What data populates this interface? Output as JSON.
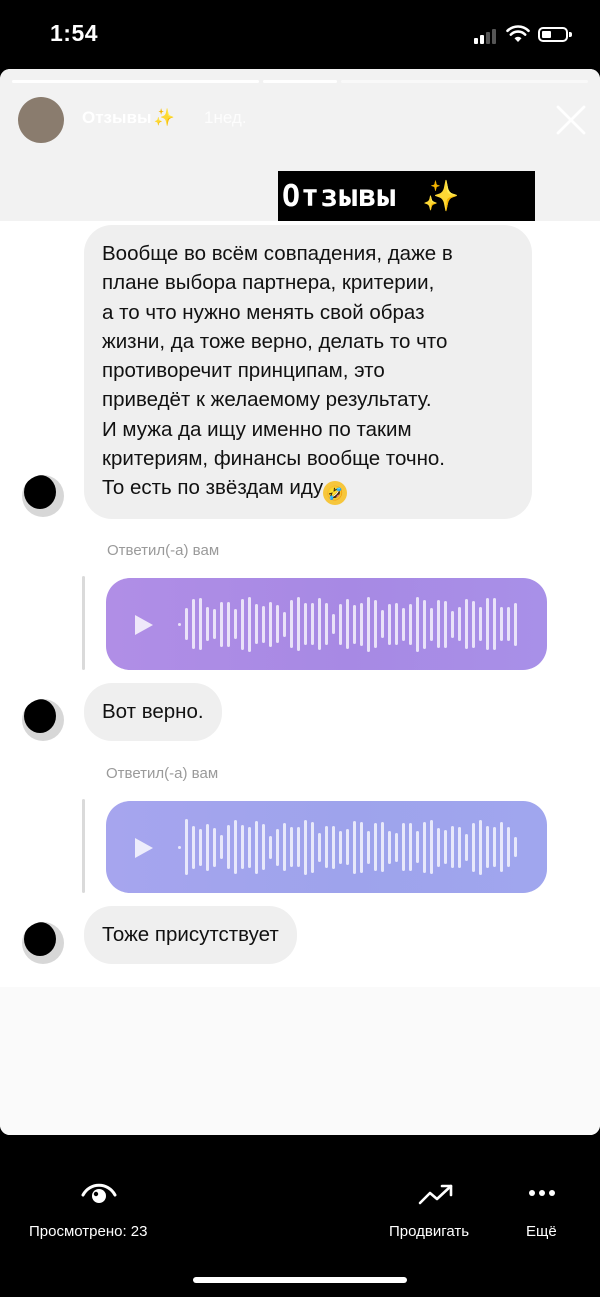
{
  "status_bar": {
    "time": "1:54"
  },
  "story": {
    "username": "Отзывы",
    "username_emoji": "✨",
    "age": "1нед.",
    "progress_segments": 3,
    "active_segment": 1,
    "title_sticker": "Отзывы",
    "title_sticker_emoji": "✨"
  },
  "chat": {
    "message_1": {
      "lines": [
        "Вообще во всём совпадения, даже в",
        "плане выбора партнера, критерии,",
        "а то что нужно менять свой образ",
        "жизни, да тоже верно, делать то что",
        "противоречит принципам, это",
        "приведёт к желаемому результату.",
        "И мужа да ищу именно по таким",
        "критериям, финансы вообще точно.",
        "То есть по звёздам иду"
      ],
      "emoji": "🤣"
    },
    "reply_label_1": "Ответил(-а) вам",
    "voice_1_color": "#a98ae5",
    "message_2": "Вот верно.",
    "reply_label_2": "Ответил(-а) вам",
    "voice_2_color": "#a1a4ed",
    "message_3": "Тоже присутствует"
  },
  "bottom_bar": {
    "views_label": "Просмотрено: 23",
    "promote_label": "Продвигать",
    "more_label": "Ещё"
  }
}
